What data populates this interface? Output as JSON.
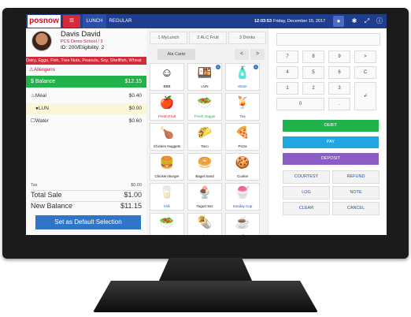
{
  "header": {
    "logo_text": "posnow",
    "menu_icon": "hamburger-icon",
    "tabs": [
      {
        "label": "LUNCH"
      },
      {
        "label": "REGULAR"
      }
    ],
    "time": "12:03:53",
    "date": "Friday, December 15, 2017",
    "icons": [
      "user-icon",
      "gear-icon",
      "expand-icon",
      "info-icon"
    ]
  },
  "student": {
    "name": "Davis David",
    "school": "PCS Demo School / 3",
    "id_line": "ID: 200/Eligibility: 2",
    "allergy_list": "Dairy, Eggs, Fish, Tree Nuts, Peanuts, Soy, Shellfish, Wheat",
    "allergens_label": "Allergens"
  },
  "cart": {
    "balance_label": "$ Balance",
    "balance_value": "$12.15",
    "rows": [
      {
        "label": "Meal",
        "value": "$0.40"
      },
      {
        "label": "LUN",
        "value": "$0.00"
      },
      {
        "label": "Water",
        "value": "$0.60"
      }
    ],
    "tax_label": "Tax",
    "tax_value": "$0.00",
    "total_label": "Total Sale",
    "total_value": "$1.00",
    "new_balance_label": "New Balance",
    "new_balance_value": "$11.15",
    "default_button": "Set as Default Selection"
  },
  "menu": {
    "tabs": [
      {
        "label": "1 MyLunch"
      },
      {
        "label": "2 ALC Fruit"
      },
      {
        "label": "3 Drinks"
      }
    ],
    "category": "Ala Carte",
    "prev": "<",
    "next": ">",
    "items": [
      {
        "name": "BBB",
        "glyph": "☺",
        "color": "#111",
        "badge": ""
      },
      {
        "name": "LUN",
        "glyph": "🍱",
        "color": "#111",
        "badge": "1"
      },
      {
        "name": "Water",
        "glyph": "🧴",
        "color": "#2f76c8",
        "badge": "1"
      },
      {
        "name": "Fresh Fruit",
        "glyph": "🍎",
        "color": "#c8102e",
        "badge": ""
      },
      {
        "name": "Fresh Veggie",
        "glyph": "🥗",
        "color": "#22b24c",
        "badge": ""
      },
      {
        "name": "Tea",
        "glyph": "🍹",
        "color": "#2f4fa6",
        "badge": ""
      },
      {
        "name": "Chicken Nuggets",
        "glyph": "🍗",
        "color": "#111",
        "badge": ""
      },
      {
        "name": "Taco",
        "glyph": "🌮",
        "color": "#111",
        "badge": ""
      },
      {
        "name": "Pizza",
        "glyph": "🍕",
        "color": "#111",
        "badge": ""
      },
      {
        "name": "Chicken Burger",
        "glyph": "🍔",
        "color": "#111",
        "badge": ""
      },
      {
        "name": "Bagel Sand",
        "glyph": "🥯",
        "color": "#111",
        "badge": ""
      },
      {
        "name": "Cookie",
        "glyph": "🍪",
        "color": "#111",
        "badge": ""
      },
      {
        "name": "Milk",
        "glyph": "🥛",
        "color": "#2f76c8",
        "badge": ""
      },
      {
        "name": "Yogurt 8oz",
        "glyph": "🍨",
        "color": "#111",
        "badge": ""
      },
      {
        "name": "Sunday Cup",
        "glyph": "🍧",
        "color": "#2f4fa6",
        "badge": ""
      },
      {
        "name": "Salad",
        "glyph": "🥗",
        "color": "#22b24c",
        "badge": ""
      },
      {
        "name": "Greek Wrap",
        "glyph": "🌯",
        "color": "#111",
        "badge": ""
      },
      {
        "name": "Coffee",
        "glyph": "☕",
        "color": "#111",
        "badge": ""
      }
    ]
  },
  "keypad": {
    "keys": [
      [
        "7",
        "8",
        "9",
        ">"
      ],
      [
        "4",
        "5",
        "6",
        "C"
      ],
      [
        "1",
        "2",
        "3",
        ""
      ],
      [
        "0",
        "",
        ".",
        "↲"
      ]
    ],
    "actions": [
      {
        "label": "DEBIT",
        "color": "#22b24c"
      },
      {
        "label": "PAY",
        "color": "#1ea7e1"
      },
      {
        "label": "DEPOSIT",
        "color": "#8a5cc4"
      }
    ],
    "secondary": [
      "COURTESY",
      "REFUND",
      "LOG",
      "NOTE",
      "CLEAR",
      "CANCEL"
    ]
  }
}
